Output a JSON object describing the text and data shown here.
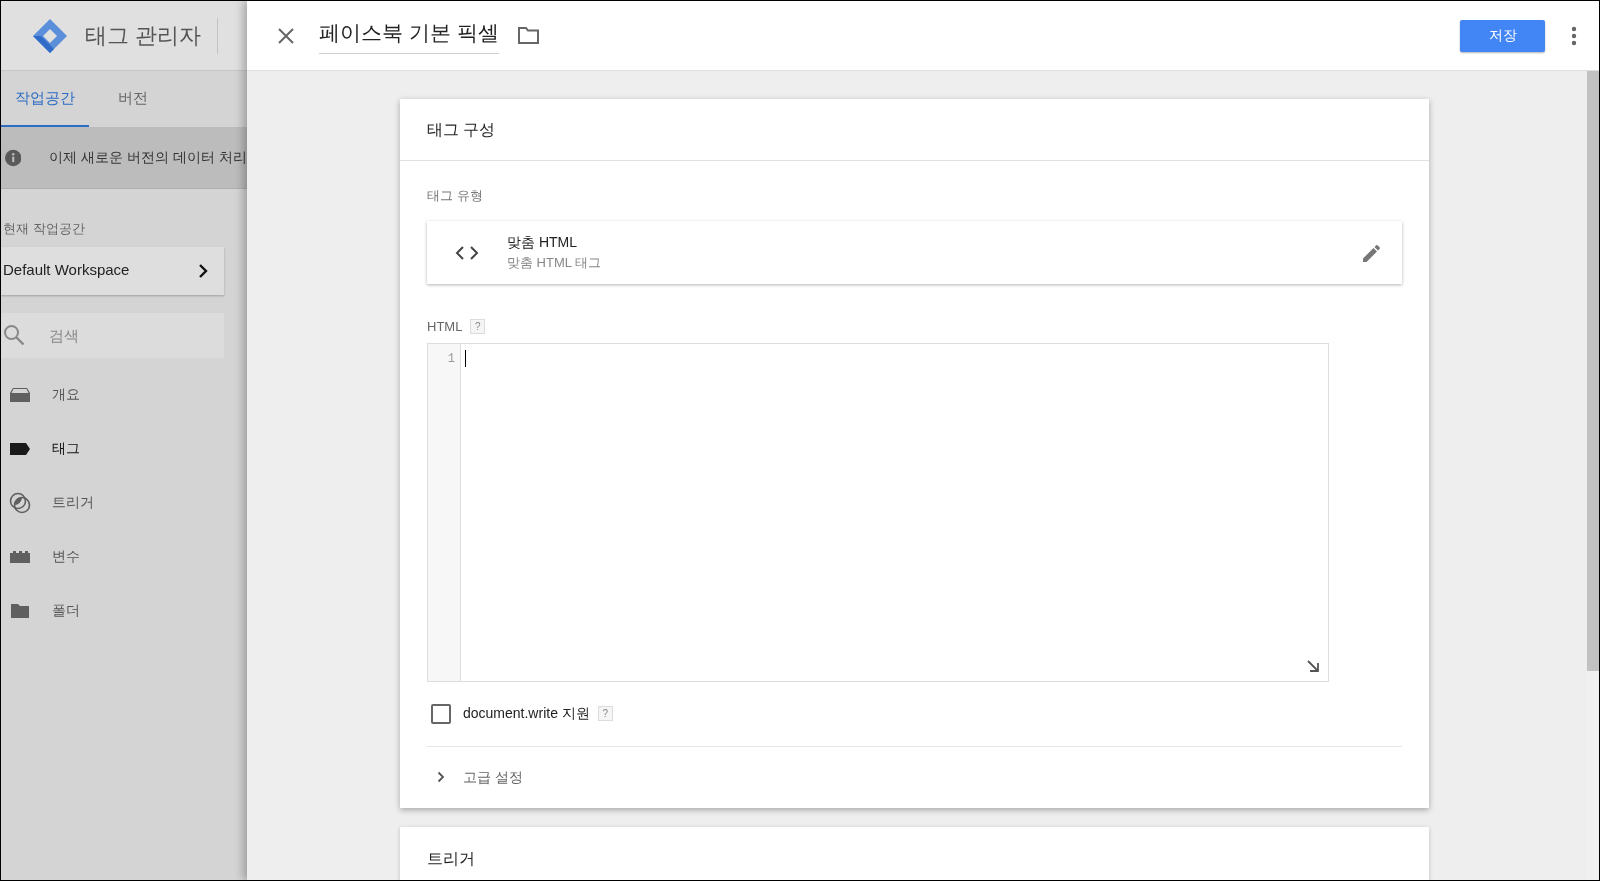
{
  "app": {
    "title": "태그 관리자"
  },
  "tabs": [
    {
      "label": "작업공간",
      "selected": true
    },
    {
      "label": "버전",
      "selected": false
    }
  ],
  "notice": "이제 새로운 버전의 데이터 처리",
  "workspace": {
    "label": "현재 작업공간",
    "name": "Default Workspace"
  },
  "search": {
    "placeholder": "검색"
  },
  "nav": [
    {
      "label": "개요",
      "selected": false,
      "kind": "overview"
    },
    {
      "label": "태그",
      "selected": true,
      "kind": "tag"
    },
    {
      "label": "트리거",
      "selected": false,
      "kind": "trigger"
    },
    {
      "label": "변수",
      "selected": false,
      "kind": "variable"
    },
    {
      "label": "폴더",
      "selected": false,
      "kind": "folder"
    }
  ],
  "editor": {
    "title": "페이스북 기본 픽셀",
    "save": "저장"
  },
  "tag_config": {
    "heading": "태그 구성",
    "type_label": "태그 유형",
    "type_name": "맞춤 HTML",
    "type_desc": "맞춤 HTML 태그",
    "html_label": "HTML",
    "html_help": "?",
    "line_numbers": [
      "1"
    ],
    "checkbox": {
      "label": "document.write 지원",
      "checked": false,
      "help": "?"
    },
    "advanced": {
      "label": "고급 설정",
      "expanded": false
    }
  },
  "trigger": {
    "heading": "트리거"
  }
}
